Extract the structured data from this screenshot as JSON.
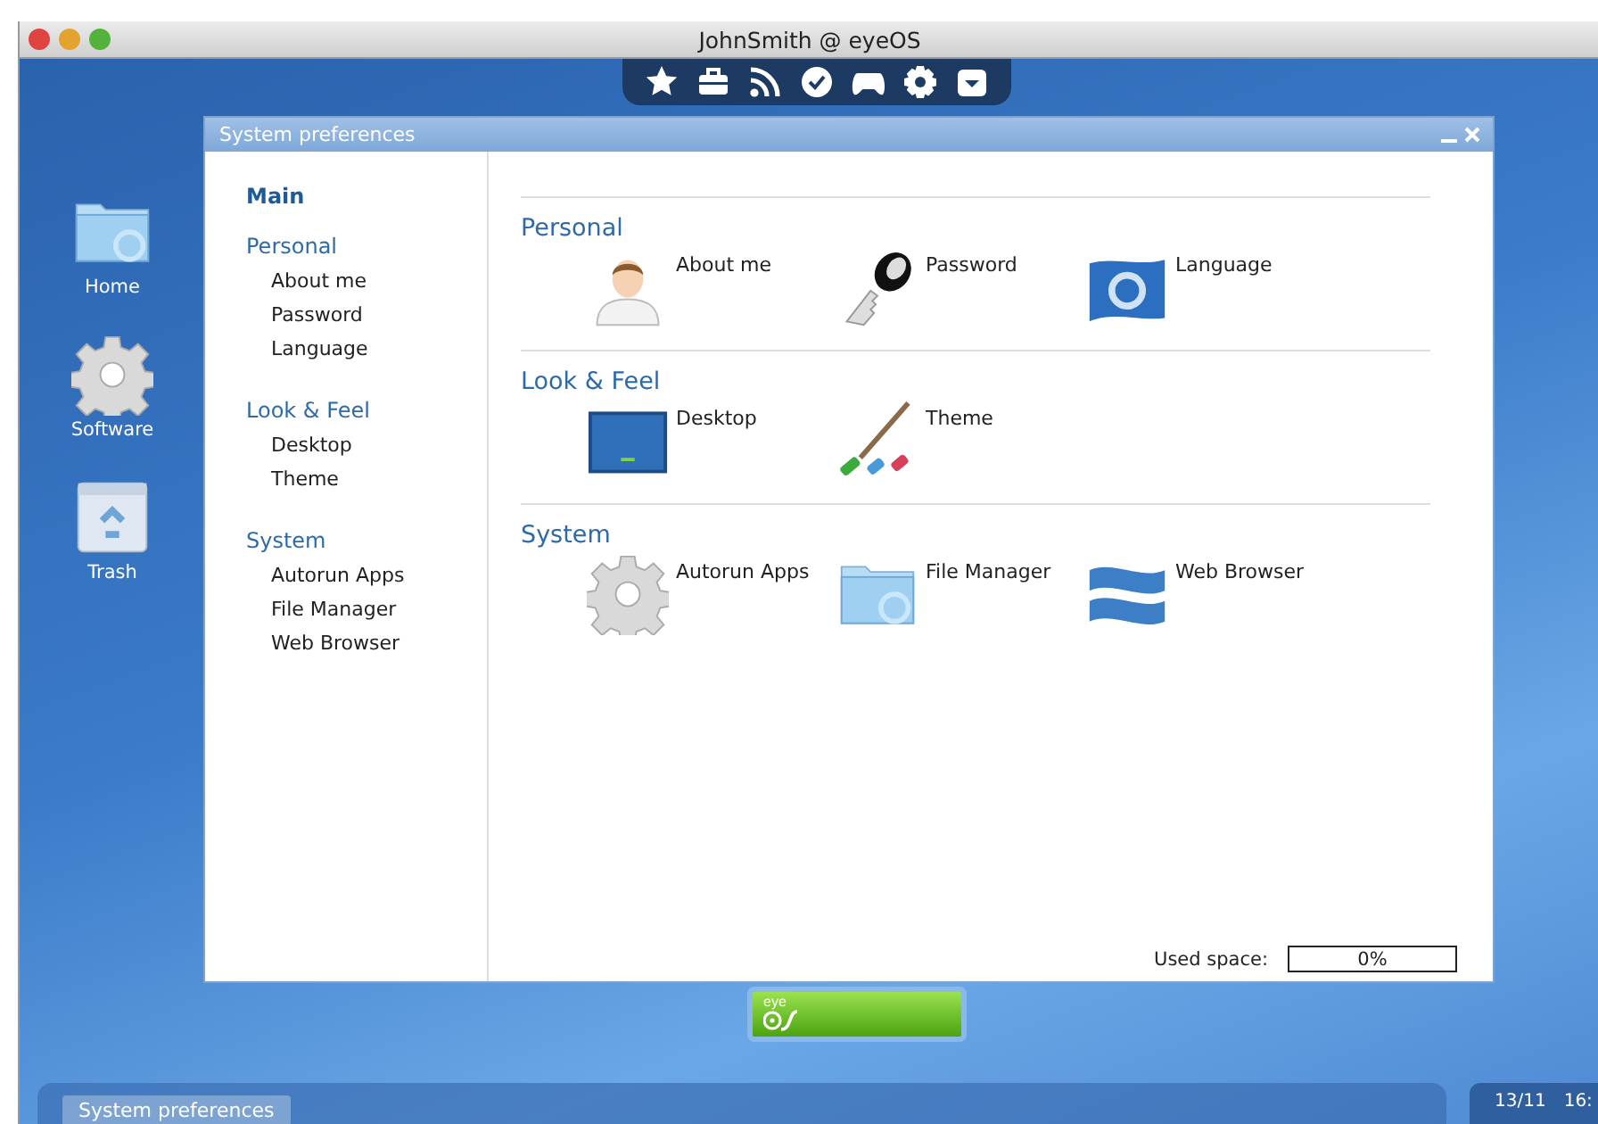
{
  "title_bar": {
    "title": "JohnSmith @ eyeOS"
  },
  "desktop_icons": [
    {
      "label": "Home",
      "kind": "folder"
    },
    {
      "label": "Software",
      "kind": "gear"
    },
    {
      "label": "Trash",
      "kind": "trash"
    }
  ],
  "prefs_window": {
    "title": "System preferences",
    "sidebar": {
      "main": "Main",
      "groups": [
        {
          "title": "Personal",
          "items": [
            "About me",
            "Password",
            "Language"
          ]
        },
        {
          "title": "Look & Feel",
          "items": [
            "Desktop",
            "Theme"
          ]
        },
        {
          "title": "System",
          "items": [
            "Autorun Apps",
            "File Manager",
            "Web Browser"
          ]
        }
      ]
    },
    "sections": [
      {
        "title": "Personal",
        "items": [
          {
            "label": "About me",
            "kind": "person"
          },
          {
            "label": "Password",
            "kind": "key"
          },
          {
            "label": "Language",
            "kind": "flag"
          }
        ]
      },
      {
        "title": "Look & Feel",
        "items": [
          {
            "label": "Desktop",
            "kind": "screen"
          },
          {
            "label": "Theme",
            "kind": "brush"
          }
        ]
      },
      {
        "title": "System",
        "items": [
          {
            "label": "Autorun Apps",
            "kind": "gear"
          },
          {
            "label": "File Manager",
            "kind": "folder"
          },
          {
            "label": "Web Browser",
            "kind": "waves"
          }
        ]
      }
    ],
    "used_space": {
      "label": "Used space:",
      "level": 0,
      "reading": "0%"
    }
  },
  "logo_button": {
    "text": "eye"
  },
  "taskbar": {
    "tasks": [
      {
        "label": "System preferences",
        "selected": true
      }
    ],
    "date": "13/11",
    "time": "16:"
  }
}
